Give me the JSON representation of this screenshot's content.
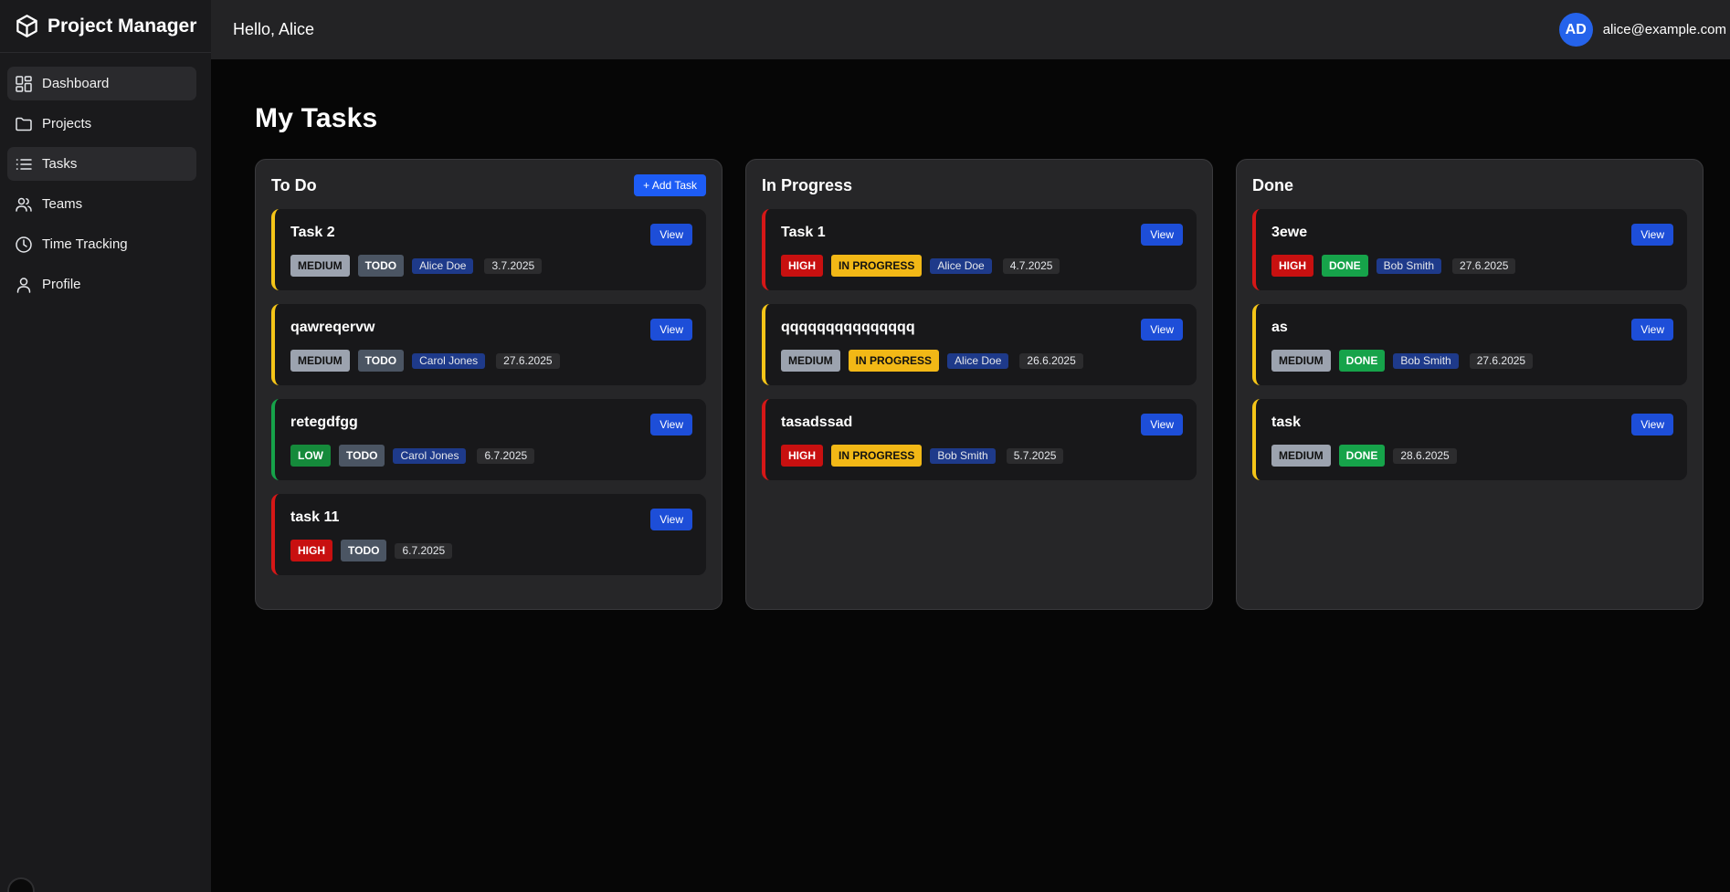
{
  "app": {
    "title": "Project Manager"
  },
  "sidebar": {
    "items": [
      {
        "label": "Dashboard",
        "icon": "dashboard-icon"
      },
      {
        "label": "Projects",
        "icon": "folder-icon"
      },
      {
        "label": "Tasks",
        "icon": "list-icon"
      },
      {
        "label": "Teams",
        "icon": "users-icon"
      },
      {
        "label": "Time Tracking",
        "icon": "clock-icon"
      },
      {
        "label": "Profile",
        "icon": "user-icon"
      }
    ]
  },
  "header": {
    "greeting": "Hello, Alice",
    "avatar_initials": "AD",
    "email": "alice@example.com"
  },
  "page": {
    "title": "My Tasks"
  },
  "columns": [
    {
      "title": "To Do",
      "add_label": "+ Add Task",
      "tasks": [
        {
          "title": "Task 2",
          "priority": "MEDIUM",
          "status": "TODO",
          "assignee": "Alice Doe",
          "date": "3.7.2025",
          "view_label": "View"
        },
        {
          "title": "qawreqervw",
          "priority": "MEDIUM",
          "status": "TODO",
          "assignee": "Carol Jones",
          "date": "27.6.2025",
          "view_label": "View"
        },
        {
          "title": "retegdfgg",
          "priority": "LOW",
          "status": "TODO",
          "assignee": "Carol Jones",
          "date": "6.7.2025",
          "view_label": "View"
        },
        {
          "title": "task 11",
          "priority": "HIGH",
          "status": "TODO",
          "assignee": "",
          "date": "6.7.2025",
          "view_label": "View"
        }
      ]
    },
    {
      "title": "In Progress",
      "add_label": "",
      "tasks": [
        {
          "title": "Task 1",
          "priority": "HIGH",
          "status": "IN PROGRESS",
          "assignee": "Alice Doe",
          "date": "4.7.2025",
          "view_label": "View"
        },
        {
          "title": "qqqqqqqqqqqqqqq",
          "priority": "MEDIUM",
          "status": "IN PROGRESS",
          "assignee": "Alice Doe",
          "date": "26.6.2025",
          "view_label": "View"
        },
        {
          "title": "tasadssad",
          "priority": "HIGH",
          "status": "IN PROGRESS",
          "assignee": "Bob Smith",
          "date": "5.7.2025",
          "view_label": "View"
        }
      ]
    },
    {
      "title": "Done",
      "add_label": "",
      "tasks": [
        {
          "title": "3ewe",
          "priority": "HIGH",
          "status": "DONE",
          "assignee": "Bob Smith",
          "date": "27.6.2025",
          "view_label": "View"
        },
        {
          "title": "as",
          "priority": "MEDIUM",
          "status": "DONE",
          "assignee": "Bob Smith",
          "date": "27.6.2025",
          "view_label": "View"
        },
        {
          "title": "task",
          "priority": "MEDIUM",
          "status": "DONE",
          "assignee": "",
          "date": "28.6.2025",
          "view_label": "View"
        }
      ]
    }
  ],
  "colors": {
    "accent": "#2563eb",
    "priority_high": "#c81010",
    "priority_medium": "#9ca3af",
    "priority_low": "#158a3b",
    "status_todo": "#4b5563",
    "status_in_progress": "#f2b816",
    "status_done": "#16a34a"
  }
}
